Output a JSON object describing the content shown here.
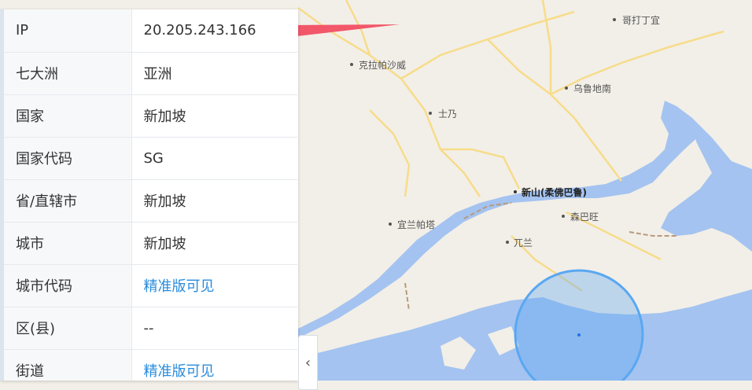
{
  "rows": [
    {
      "key": "IP",
      "value": "20.205.243.166",
      "link": false
    },
    {
      "key": "七大洲",
      "value": "亚洲",
      "link": false
    },
    {
      "key": "国家",
      "value": "新加坡",
      "link": false
    },
    {
      "key": "国家代码",
      "value": "SG",
      "link": false
    },
    {
      "key": "省/直辖市",
      "value": "新加坡",
      "link": false
    },
    {
      "key": "城市",
      "value": "新加坡",
      "link": false
    },
    {
      "key": "城市代码",
      "value": "精准版可见",
      "link": true
    },
    {
      "key": "区(县)",
      "value": "--",
      "link": false
    },
    {
      "key": "街道",
      "value": "精准版可见",
      "link": true
    }
  ],
  "map": {
    "places": [
      "哥打丁宜",
      "克拉帕沙威",
      "乌鲁地南",
      "士乃",
      "新山(柔佛巴鲁)",
      "森巴旺",
      "宜兰帕塔",
      "兀兰"
    ],
    "colors": {
      "land": "#f2efe8",
      "water": "#a4c3f0",
      "road": "#f7dc8a",
      "arrow": "#f2576a",
      "circle": "#5aa7f2"
    }
  },
  "collapse_icon": "chevron-left-icon"
}
